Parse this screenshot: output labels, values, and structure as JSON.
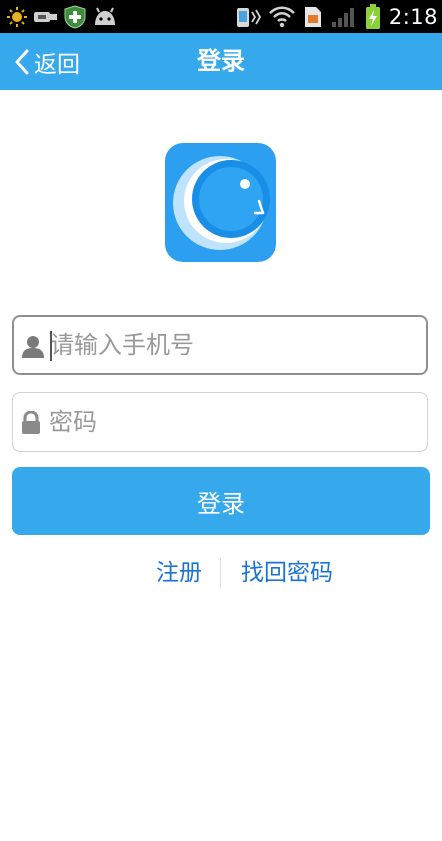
{
  "status_bar": {
    "time": "2:18",
    "icons_left": [
      "sun-icon",
      "usb-icon",
      "shield-plus-icon",
      "android-icon"
    ],
    "icons_right": [
      "vibrate-icon",
      "wifi-icon",
      "sim-icon",
      "signal-icon",
      "battery-charging-icon"
    ]
  },
  "header": {
    "back_label": "返回",
    "title": "登录",
    "background": "#36a9ec"
  },
  "logo": {
    "icon": "app-logo-icon",
    "background": "#2c9ff0"
  },
  "form": {
    "phone": {
      "value": "",
      "placeholder": "请输入手机号",
      "icon": "user-icon"
    },
    "password": {
      "value": "",
      "placeholder": "密码",
      "icon": "lock-icon"
    },
    "submit_label": "登录"
  },
  "links": {
    "register": "注册",
    "forgot_password": "找回密码",
    "color": "#1a73d8"
  }
}
